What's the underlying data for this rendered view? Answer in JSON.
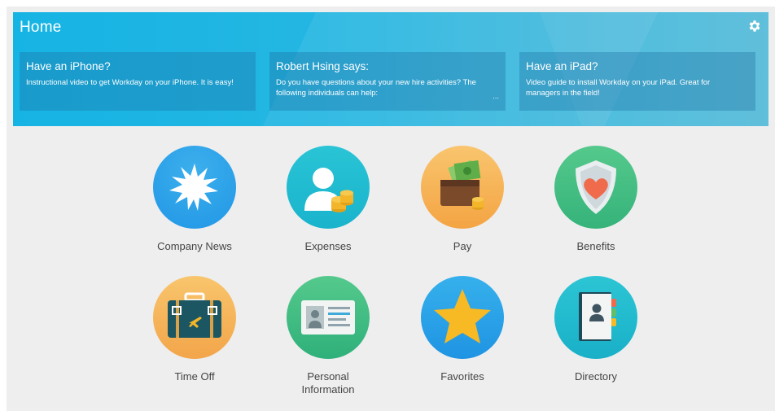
{
  "banner": {
    "title": "Home",
    "cards": [
      {
        "title": "Have an iPhone?",
        "body": "Instructional video to get Workday on your iPhone. It is easy!"
      },
      {
        "title": "Robert Hsing says:",
        "body": "Do you have questions about your new hire activities? The following individuals can help:",
        "more": "..."
      },
      {
        "title": "Have an iPad?",
        "body": "Video guide to install Workday on your iPad.  Great for managers in the field!"
      }
    ]
  },
  "tiles": [
    {
      "label": "Company News",
      "icon": "starburst-icon"
    },
    {
      "label": "Expenses",
      "icon": "person-coins-icon"
    },
    {
      "label": "Pay",
      "icon": "wallet-icon"
    },
    {
      "label": "Benefits",
      "icon": "shield-heart-icon"
    },
    {
      "label": "Time Off",
      "icon": "suitcase-icon"
    },
    {
      "label": "Personal Information",
      "icon": "id-card-icon"
    },
    {
      "label": "Favorites",
      "icon": "star-icon"
    },
    {
      "label": "Directory",
      "icon": "address-book-icon"
    }
  ],
  "colors": {
    "banner": "#16b4e4",
    "page_bg": "#eeeeef"
  }
}
